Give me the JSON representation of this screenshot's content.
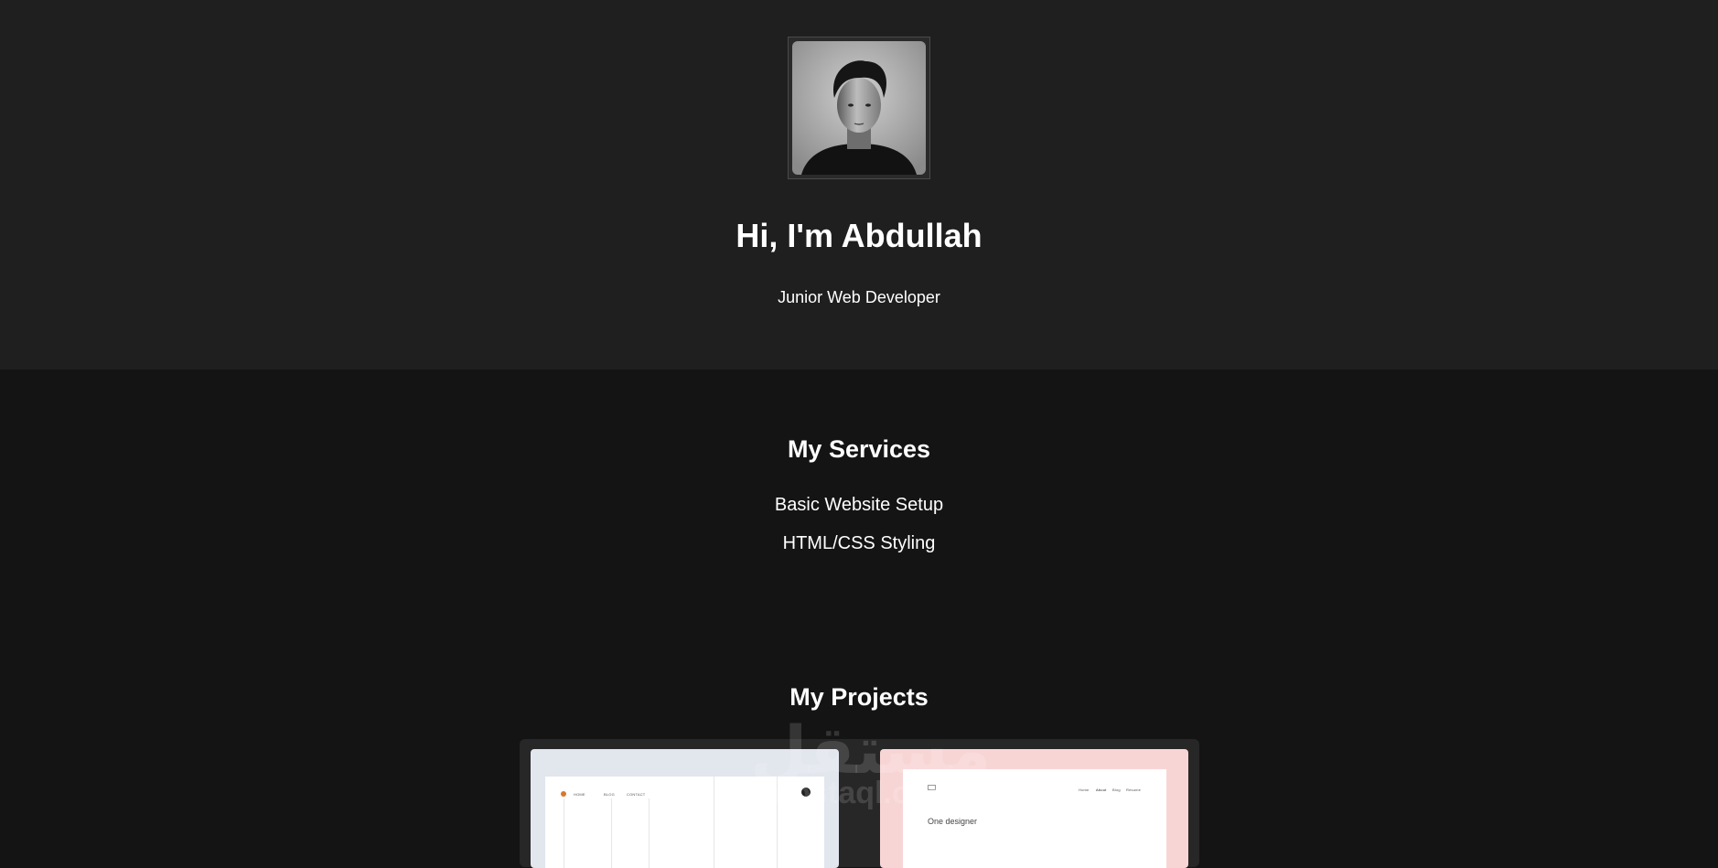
{
  "hero": {
    "title": "Hi, I'm Abdullah",
    "subtitle": "Junior Web Developer"
  },
  "services": {
    "title": "My Services",
    "items": [
      "Basic Website Setup",
      "HTML/CSS Styling"
    ]
  },
  "projects": {
    "title": "My Projects",
    "cards": [
      {
        "nav_items": [
          "HOME",
          "BLOG",
          "CONTACT"
        ],
        "accent": "#d9782b"
      },
      {
        "nav_items": [
          "Home",
          "About",
          "Blog",
          "Resume"
        ],
        "heading": "One designer"
      }
    ]
  },
  "watermark": {
    "arabic": "مستقل",
    "latin": "mostaql.com"
  },
  "colors": {
    "hero_bg": "#1f1f1f",
    "page_bg": "#141414",
    "text": "#ffffff"
  }
}
